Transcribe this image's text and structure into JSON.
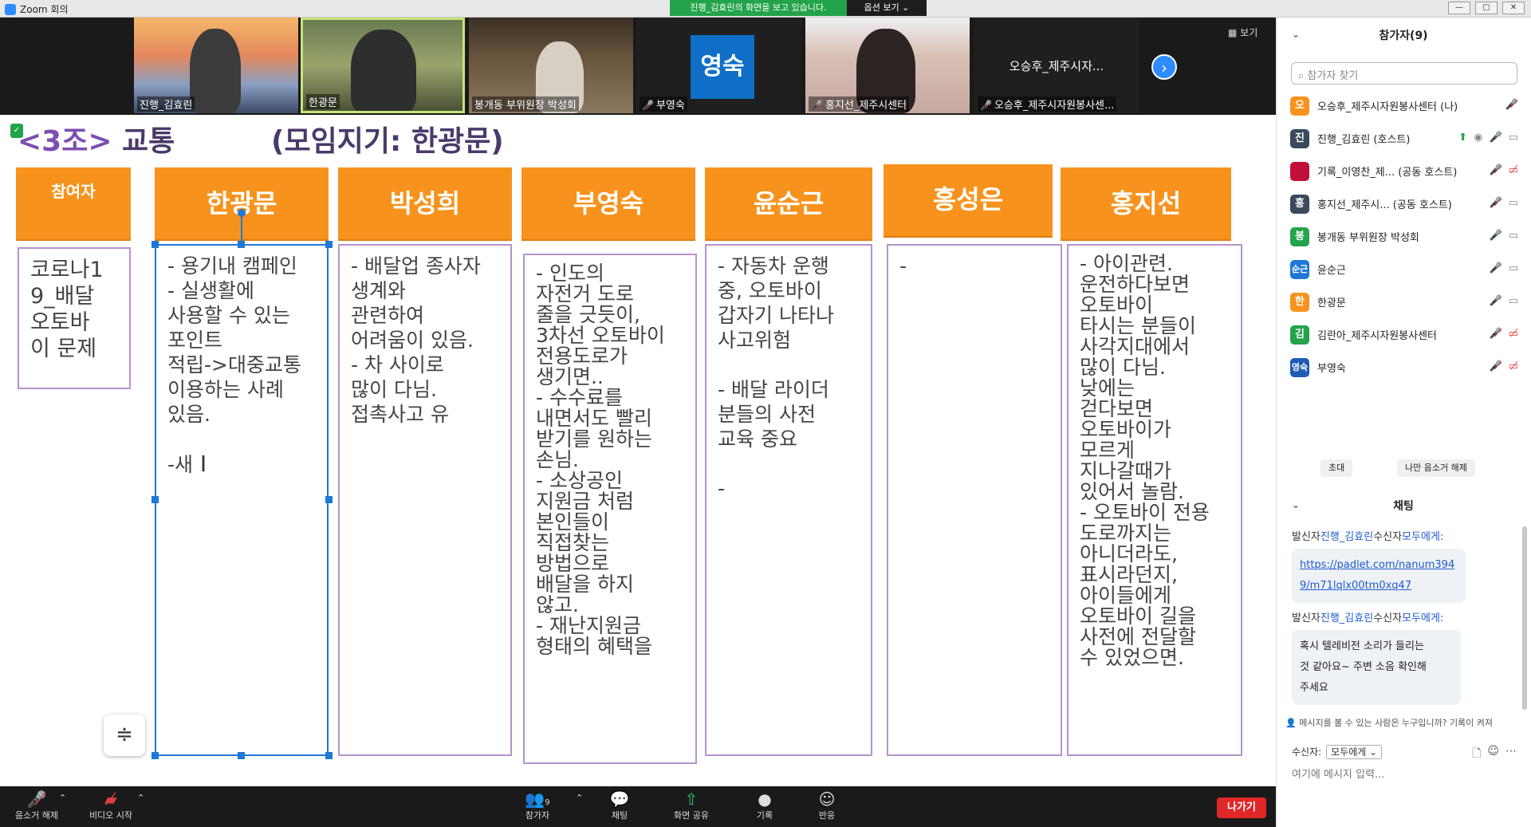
{
  "window": {
    "title": "Zoom 회의",
    "share_banner": "진행_김효린의 화면을 보고 있습니다.",
    "view_options": "옵션 보기 ⌄"
  },
  "video_strip": {
    "tiles": [
      {
        "name": "진행_김효린"
      },
      {
        "name": "한광문"
      },
      {
        "name": "봉개동 부위원장 박성회"
      },
      {
        "name": "부영숙",
        "avatar": "영숙"
      },
      {
        "name": "홍지선_제주시센터"
      },
      {
        "name": "오승후_제주시자원봉사센...",
        "center_label": "오승후_제주시자..."
      }
    ],
    "view_label": "보기"
  },
  "slide": {
    "group": "<3조>",
    "topic": "교통",
    "facilitator": "(모임지기: 한광문)",
    "columns": [
      {
        "header": "참여자",
        "content": "코로나1\n9_배달\n오토바\n이 문제"
      },
      {
        "header": "한광문",
        "content": "- 용기내 캠페인\n- 실생활에\n사용할 수 있는\n포인트\n적립->대중교통\n이용하는 사례\n있음.\n\n-새"
      },
      {
        "header": "박성희",
        "content": "- 배달업 종사자\n생계와\n관련하여\n어려움이 있음.\n- 차 사이로\n많이 다님.\n접촉사고 유"
      },
      {
        "header": "부영숙",
        "content": "- 인도의\n자전거 도로\n줄을 긋듯이,\n3차선 오토바이\n전용도로가\n생기면..\n- 수수료를\n내면서도 빨리\n받기를 원하는\n손님.\n- 소상공인\n지원금 처럼\n본인들이\n직접찾는\n방법으로\n배달을 하지\n않고.\n- 재난지원금\n형태의 혜택을"
      },
      {
        "header": "윤순근",
        "content": "- 자동차 운행\n중, 오토바이\n갑자기 나타나\n사고위험\n\n- 배달 라이더\n분들의 사전\n교육 중요\n\n-"
      },
      {
        "header": "홍성은",
        "content": "-"
      },
      {
        "header": "홍지선",
        "content": "- 아이관련.\n운전하다보면\n오토바이\n타시는 분들이\n사각지대에서\n많이 다님.\n낮에는\n걷다보면\n오토바이가\n모르게\n지나갈때가\n있어서 놀람.\n- 오토바이 전용\n도로까지는\n아니더라도,\n표시라던지,\n아이들에게\n오토바이 길을\n사전에 전달할\n수 있었으면."
      }
    ]
  },
  "toolbar": {
    "unmute": "음소거 해제",
    "start_video": "비디오 시작",
    "participants": "참가자",
    "participant_count": "9",
    "chat": "채팅",
    "share_screen": "화면 공유",
    "record": "기록",
    "reactions": "반응",
    "leave": "나가기"
  },
  "participants_panel": {
    "title": "참가자(9)",
    "search_placeholder": "참가자 찾기",
    "participants": [
      {
        "initial": "오",
        "name": "오승후_제주시자원봉사센터 (나)",
        "color": "#f7931d"
      },
      {
        "initial": "진",
        "name": "진행_김효린 (호스트)",
        "color": "#3a4a5c"
      },
      {
        "initial": "",
        "name": "기록_이영찬_제... (공동 호스트)",
        "color": "#c0103a"
      },
      {
        "initial": "홍",
        "name": "홍지선_제주시... (공동 호스트)",
        "color": "#3a4a5c"
      },
      {
        "initial": "봉",
        "name": "봉개동 부위원장 박성회",
        "color": "#23a34a"
      },
      {
        "initial": "순근",
        "name": "윤순근",
        "color": "#1e78d6"
      },
      {
        "initial": "한",
        "name": "한광문",
        "color": "#f7931d"
      },
      {
        "initial": "김",
        "name": "김란아_제주시자원봉사센터",
        "color": "#23a34a"
      },
      {
        "initial": "영숙",
        "name": "부영숙",
        "color": "#1e5bb5"
      }
    ],
    "invite": "초대",
    "mute_me": "나만 음소거 해제"
  },
  "chat_panel": {
    "title": "채팅",
    "messages": [
      {
        "prefix": "발신자",
        "sender": "진행_김효린",
        "mid": "수신자",
        "to": "모두에게:",
        "text": "https://padlet.com/nanum394\n9/m71lqlx00tm0xq47"
      },
      {
        "prefix": "발신자",
        "sender": "진행_김효린",
        "mid": "수신자",
        "to": "모두에게:",
        "text": "혹시 텔레비전 소리가 들리는\n것 같아요~ 주변 소음 확인해\n주세요"
      }
    ],
    "privacy_note": "메시지를 볼 수 있는 사람은 누구입니까? 기록이 켜져",
    "recipient_label": "수신자:",
    "recipient_value": "모두에게",
    "input_placeholder": "여기에 메시지 입력..."
  }
}
